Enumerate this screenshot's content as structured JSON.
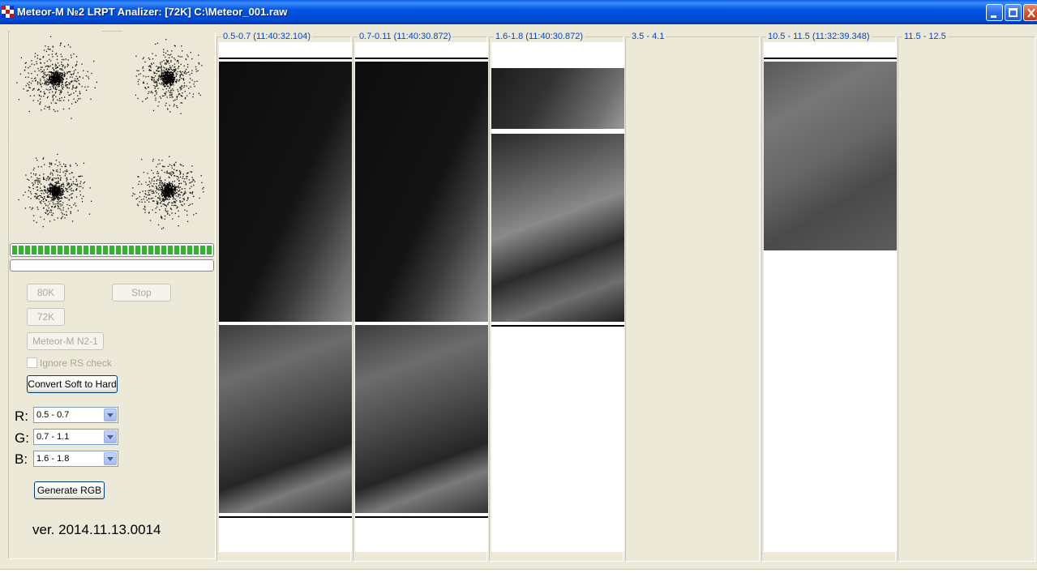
{
  "window": {
    "title": "Meteor-M №2 LRPT Analizer: [72K] C:\\Meteor_001.raw",
    "title_colors": {
      "active": "#0054e3"
    }
  },
  "controls": {
    "btn_80k": "80K",
    "btn_stop": "Stop",
    "btn_72k": "72K",
    "btn_meteor": "Meteor-M N2-1",
    "ignore_rs": "Ignore RS check",
    "convert": "Convert Soft to Hard",
    "generate_rgb": "Generate RGB",
    "r_label": "R:",
    "g_label": "G:",
    "b_label": "B:",
    "r_value": "0.5 - 0.7",
    "g_value": "0.7 - 1.1",
    "b_value": "1.6 - 1.8",
    "progress_fill": 1.0
  },
  "version": "ver. 2014.11.13.0014",
  "channels": [
    {
      "label": "0.5-0.7 (11:40:32.104)"
    },
    {
      "label": "0.7-0.11 (11:40:30.872)"
    },
    {
      "label": "1.6-1.8 (11:40:30.872)"
    },
    {
      "label": "3.5 - 4.1"
    },
    {
      "label": "10.5 - 11.5 (11:32:39.348)"
    },
    {
      "label": "11.5 - 12.5"
    }
  ],
  "icons": [
    "app-icon",
    "minimize-icon",
    "maximize-icon",
    "close-icon",
    "dropdown-arrow-icon"
  ],
  "colors": {
    "accent": "#0046d5",
    "progress": "#31b531",
    "face": "#ece9d8"
  }
}
